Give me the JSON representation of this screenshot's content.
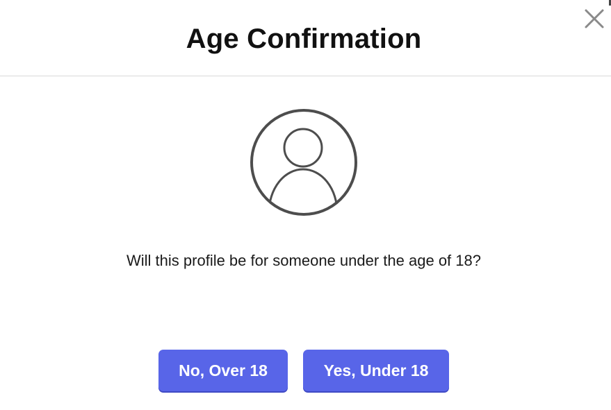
{
  "dialog": {
    "title": "Age Confirmation",
    "question": "Will this profile be for someone under the age of 18?",
    "buttons": {
      "no_label": "No, Over 18",
      "yes_label": "Yes, Under 18"
    },
    "icons": {
      "close": "close-icon",
      "avatar": "user-profile-icon"
    },
    "colors": {
      "button": "#5865e8",
      "title": "#111111",
      "icon": "#4d4d4d"
    }
  }
}
